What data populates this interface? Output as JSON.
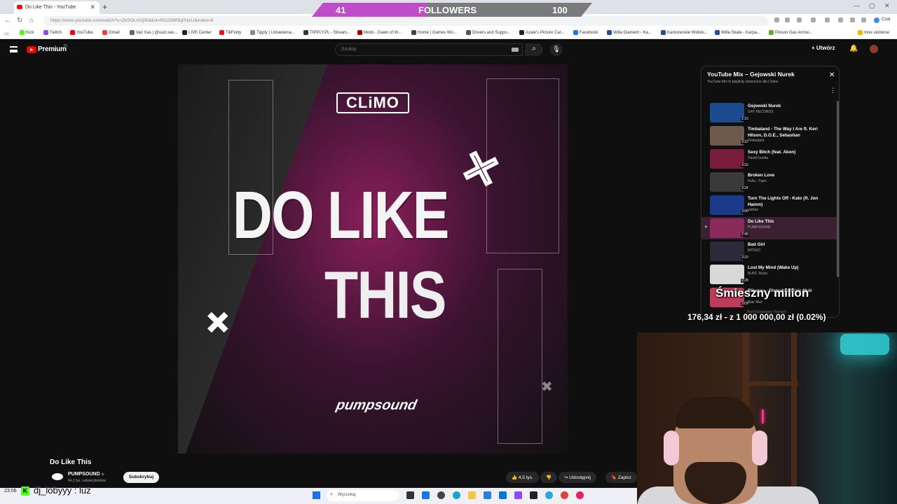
{
  "browser": {
    "tab_title": "Do Like This - YouTube",
    "url": "https://www.youtube.com/watch?v=ZbSOLAGj90&list=RD2S6REjPi1kU&index=6",
    "bookmarks": [
      "Kick",
      "Twitch",
      "YouTube",
      "Gmail",
      "Vaz Xas | @vazi.xas...",
      "LIVE Center",
      "TikFinity",
      "Tipply | Ustawienia...",
      "TIPPLY.PL - Stream...",
      "Mods - Dawn of W...",
      "Home | Games Wo...",
      "Drivers and Suppo...",
      "Azale's Picture Car...",
      "Facebook",
      "Willa Diament - Ka...",
      "Karkonoskie Widoki...",
      "Willa Skale - Karpa...",
      "Poison Gas Arrow..."
    ],
    "bookmarks_other": "Inne ulubione",
    "profile_label": "Czat"
  },
  "overlay": {
    "followers_current": "41",
    "followers_label": "FOLLOWERS",
    "followers_goal": "100",
    "followers_progress": 0.41,
    "donation_title": "Śmieszny milion",
    "donation_amount": "176,34 zł - z 1 000 000,00 zł (0.02%)"
  },
  "youtube": {
    "brand": "Premium",
    "region": "PL",
    "search_placeholder": "Szukaj",
    "create_label": "Utwórz",
    "video": {
      "cover_brand": "CLiMO",
      "cover_line1": "DO LIKE",
      "cover_line2": "THIS",
      "cover_logo": "pumpsound"
    },
    "title": "Do Like This",
    "channel": "PUMPSOUND",
    "subscribers": "64,2 tys. subskrybentów",
    "subscribe_label": "Subskrybuj",
    "likes": "4,5 tys.",
    "share_label": "Udostępnij",
    "save_label": "Zapisz"
  },
  "playlist": {
    "title": "YouTube Mix – Gejowski Nurek",
    "subtitle": "YouTube Mix to playlisty stworzone dla Ciebie",
    "items": [
      {
        "title": "Gejowski Nurek",
        "artist": "GAY RECORDS",
        "duration": "2:10",
        "color": "#1c4a8f"
      },
      {
        "title": "Timbaland - The Way I Are ft. Keri Hilson, D.O.E., Sebastian",
        "artist": "Timbaland",
        "duration": "3:32",
        "color": "#6d5a4a"
      },
      {
        "title": "Sexy Bitch (feat. Akon)",
        "artist": "David Guetta",
        "duration": "3:16",
        "color": "#7a1c3c"
      },
      {
        "title": "Broken Love",
        "artist": "Fella - Topic",
        "duration": "3:24",
        "color": "#3a3a3a"
      },
      {
        "title": "Turn The Lights Off - Kato (ft. Jon Hamm)",
        "artist": "usMan",
        "duration": "3:00",
        "color": "#1a3a8a"
      },
      {
        "title": "Do Like This",
        "artist": "PUMPSOUND",
        "duration": "2:46",
        "color": "#8a2a5a"
      },
      {
        "title": "Bad Girl",
        "artist": "MTRXO",
        "duration": "3:10",
        "color": "#2a2a3a"
      },
      {
        "title": "Lost My Mind (Wake Up)",
        "artist": "BUNT. Music",
        "duration": "2:28",
        "color": "#d8d8d8"
      },
      {
        "title": "Rihanna - Disturbia (Blais Muir",
        "artist": "Blair Muir",
        "duration": "3:09",
        "color": "#c03a5a"
      }
    ],
    "partial_item": "Pool (Gravegerz Version)"
  },
  "taskbar": {
    "time": "23:06",
    "search_placeholder": "Wyszukaj"
  },
  "chat": {
    "user": "dj_lobyyy",
    "message": " : luz"
  }
}
